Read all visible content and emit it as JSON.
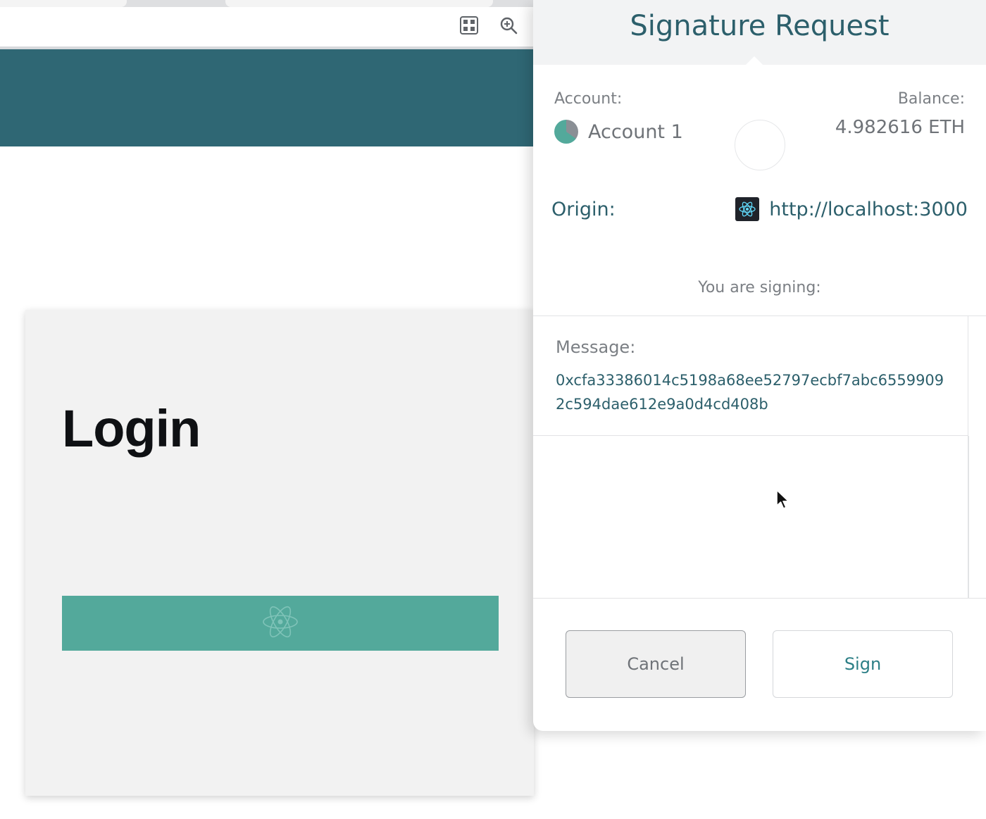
{
  "browser": {
    "toolbar_icons": [
      "qr-code-icon",
      "zoom-icon"
    ]
  },
  "app": {
    "login_title": "Login",
    "login_button_icon": "react-logo-icon",
    "colors": {
      "header": "#2f6774",
      "button": "#53a99b",
      "card": "#f2f2f2"
    }
  },
  "popup": {
    "title": "Signature Request",
    "account_label": "Account:",
    "account_name": "Account 1",
    "balance_label": "Balance:",
    "balance_value": "4.982616 ETH",
    "origin_label": "Origin:",
    "origin_url": "http://localhost:3000",
    "signing_label": "You are signing:",
    "message_label": "Message:",
    "message_value": "0xcfa33386014c5198a68ee52797ecbf7abc65599092c594dae612e9a0d4cd408b",
    "cancel_label": "Cancel",
    "sign_label": "Sign",
    "colors": {
      "accent": "#2c5f6b",
      "muted": "#7b7f84"
    }
  }
}
